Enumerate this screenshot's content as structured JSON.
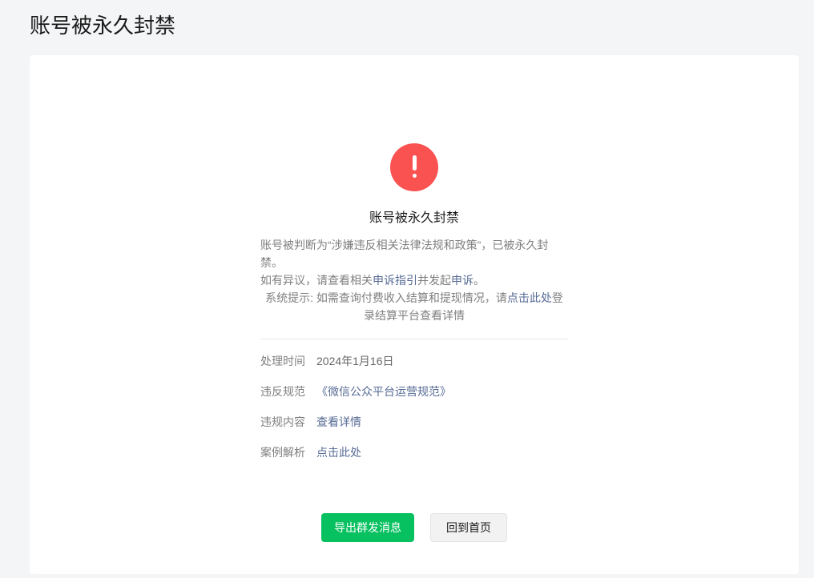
{
  "page": {
    "title": "账号被永久封禁"
  },
  "status": {
    "icon": "warning-exclamation-icon",
    "heading": "账号被永久封禁",
    "description": "账号被判断为“涉嫌违反相关法律法规和政策”，已被永久封禁。",
    "appeal": {
      "prefix": "如有异议，请查看相关",
      "guide_link": "申诉指引",
      "middle": "并发起",
      "appeal_link": "申诉",
      "suffix": "。"
    },
    "system_tip": {
      "prefix": "系统提示: 如需查询付费收入结算和提现情况，请",
      "link": "点击此处",
      "suffix": "登录结算平台查看详情"
    }
  },
  "details": [
    {
      "label": "处理时间",
      "value": "2024年1月16日"
    },
    {
      "label": "违反规范",
      "value": "《微信公众平台运营规范》"
    },
    {
      "label": "违规内容",
      "value": "查看详情"
    },
    {
      "label": "案例解析",
      "value": "点击此处"
    }
  ],
  "actions": {
    "primary_label": "导出群发消息",
    "secondary_label": "回到首页"
  },
  "colors": {
    "background": "#f4f5f7",
    "primary": "#07c160",
    "danger": "#fa5151",
    "link": "#576b95"
  }
}
